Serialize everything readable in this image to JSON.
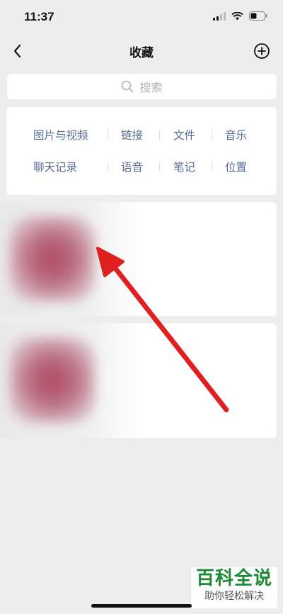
{
  "status": {
    "time": "11:37"
  },
  "nav": {
    "title": "收藏"
  },
  "search": {
    "placeholder": "搜索"
  },
  "filters": {
    "row1": [
      "图片与视频",
      "链接",
      "文件",
      "音乐"
    ],
    "row2": [
      "聊天记录",
      "语音",
      "笔记",
      "位置"
    ]
  },
  "watermark": {
    "title": "百科全说",
    "subtitle": "助你轻松解决"
  },
  "colors": {
    "background": "#ededed",
    "link": "#576b95",
    "arrow": "#e02020",
    "watermark": "#1a8a33"
  }
}
